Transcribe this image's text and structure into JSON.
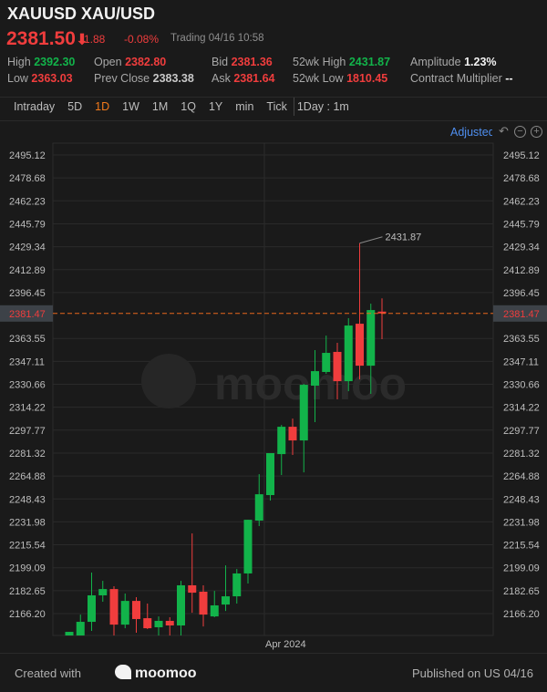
{
  "header": {
    "title": "XAUUSD XAU/USD",
    "price": "2381.50",
    "arrow": "⬇",
    "change": "-1.88",
    "change_pct": "-0.08%",
    "status": "Trading",
    "datetime": "04/16 10:58"
  },
  "stats": [
    {
      "label": "High",
      "value": "2392.30",
      "color": "green"
    },
    {
      "label": "Low",
      "value": "2363.03",
      "color": "red"
    },
    {
      "label": "Open",
      "value": "2382.80",
      "color": "red"
    },
    {
      "label": "Prev Close",
      "value": "2383.38",
      "color": "gray"
    },
    {
      "label": "Bid",
      "value": "2381.36",
      "color": "red"
    },
    {
      "label": "Ask",
      "value": "2381.64",
      "color": "red"
    },
    {
      "label": "52wk High",
      "value": "2431.87",
      "color": "green"
    },
    {
      "label": "52wk Low",
      "value": "1810.45",
      "color": "red"
    },
    {
      "label": "Amplitude",
      "value": "1.23%",
      "color": "white"
    },
    {
      "label": "Contract Multiplier",
      "value": "--",
      "color": "white"
    }
  ],
  "tabs": [
    "Intraday",
    "5D",
    "1D",
    "1W",
    "1M",
    "1Q",
    "1Y",
    "min",
    "Tick"
  ],
  "active_tab": "1D",
  "interval": "1Day : 1m",
  "toolbar": {
    "adjusted": "Adjusted",
    "reset_icon": "undo-icon",
    "zoom_out_icon": "minus-circle-icon",
    "zoom_in_icon": "plus-circle-icon"
  },
  "colors": {
    "up": "#12b34a",
    "down": "#f03d3d",
    "last_price_line": "#e8661c",
    "accent": "#f27a1a"
  },
  "chart_data": {
    "type": "candlestick",
    "y_ticks": [
      "2495.12",
      "2478.68",
      "2462.23",
      "2445.79",
      "2429.34",
      "2412.89",
      "2396.45",
      "2363.55",
      "2347.11",
      "2330.66",
      "2314.22",
      "2297.77",
      "2281.32",
      "2264.88",
      "2248.43",
      "2231.98",
      "2215.54",
      "2199.09",
      "2182.65",
      "2166.20"
    ],
    "ylim": [
      2150,
      2500
    ],
    "x_label": "Apr 2024",
    "last_price": "2381.47",
    "max_annotation": "2431.87",
    "grid": true,
    "candles": [
      [
        2150.5,
        2153.1,
        2150.5,
        2153.1
      ],
      [
        2150.5,
        2165.5,
        2150.5,
        2160.3
      ],
      [
        2160.3,
        2195.6,
        2153.8,
        2179.3
      ],
      [
        2179.3,
        2189.7,
        2174.7,
        2183.8
      ],
      [
        2183.8,
        2185.8,
        2150.5,
        2158.3
      ],
      [
        2158.3,
        2180.6,
        2155.7,
        2175.3
      ],
      [
        2175.3,
        2178.0,
        2152.5,
        2162.3
      ],
      [
        2162.9,
        2173.4,
        2155.1,
        2155.7
      ],
      [
        2156.4,
        2164.2,
        2150.5,
        2161.0
      ],
      [
        2161.0,
        2163.6,
        2150.5,
        2157.7
      ],
      [
        2157.7,
        2189.7,
        2150.5,
        2186.5
      ],
      [
        2186.5,
        2223.7,
        2166.8,
        2181.2
      ],
      [
        2181.9,
        2186.5,
        2157.0,
        2165.5
      ],
      [
        2164.2,
        2182.5,
        2163.6,
        2172.1
      ],
      [
        2172.7,
        2200.8,
        2168.1,
        2178.6
      ],
      [
        2178.6,
        2198.2,
        2173.4,
        2195.0
      ],
      [
        2195.0,
        2233.5,
        2187.8,
        2233.5
      ],
      [
        2232.9,
        2266.2,
        2229.0,
        2251.8
      ],
      [
        2251.2,
        2281.3,
        2247.3,
        2281.3
      ],
      [
        2280.6,
        2301.5,
        2265.6,
        2300.2
      ],
      [
        2300.2,
        2306.1,
        2280.0,
        2290.4
      ],
      [
        2290.4,
        2331.0,
        2267.5,
        2330.3
      ],
      [
        2329.7,
        2355.2,
        2303.5,
        2340.1
      ],
      [
        2339.5,
        2365.6,
        2338.2,
        2353.2
      ],
      [
        2353.9,
        2360.4,
        2319.9,
        2332.9
      ],
      [
        2332.9,
        2378.1,
        2325.7,
        2372.8
      ],
      [
        2374.1,
        2431.87,
        2334.2,
        2344.0
      ],
      [
        2344.0,
        2388.5,
        2323.8,
        2383.9
      ],
      [
        2382.8,
        2392.3,
        2363.03,
        2381.5
      ]
    ]
  },
  "watermark": "moomoo",
  "footer": {
    "created": "Created with",
    "brand": "moomoo",
    "published": "Published on US 04/16"
  }
}
